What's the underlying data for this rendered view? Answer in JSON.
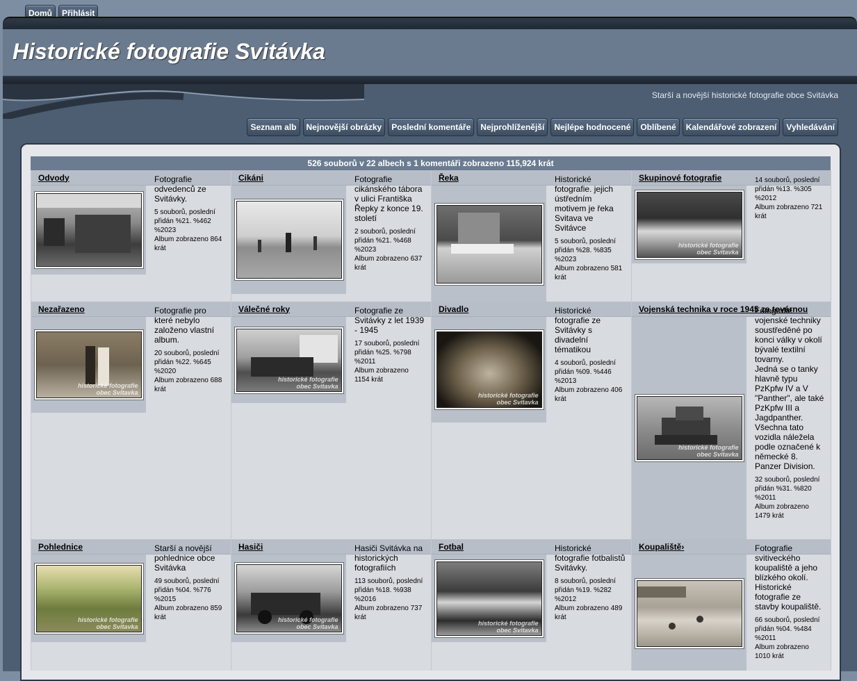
{
  "topnav": {
    "home": "Domů",
    "login": "Přihlásit"
  },
  "site": {
    "title": "Historické fotografie Svitávka",
    "description": "Starší a novější historické fotografie obce Svitávka"
  },
  "subnav": [
    "Seznam alb",
    "Nejnovější obrázky",
    "Poslední komentáře",
    "Nejprohlíženější",
    "Nejlépe hodnocené",
    "Oblíbené",
    "Kalendářové zobrazení",
    "Vyhledávání"
  ],
  "stats": "526 souborů v 22 albech s 1 komentáři zobrazeno 115,924 krát",
  "watermark": {
    "line1": "historické fotografie",
    "line2": "obec Svitavka"
  },
  "albums": [
    {
      "title": "Odvody",
      "desc": "Fotografie odvedenců ze Svitávky.",
      "files": "5 souborů, poslední přidán %21. %462 %2023",
      "views": "Album zobrazeno 864 krát"
    },
    {
      "title": "Cikáni",
      "desc": "Fotografie cikánského tábora v ulici Františka Řepky z konce 19. století",
      "files": "2 souborů, poslední přidán %21. %468 %2023",
      "views": "Album zobrazeno 637 krát"
    },
    {
      "title": "Řeka",
      "desc": "Historické fotografie. jejich ústředním motivem je řeka Svitava ve Svitávce",
      "files": "5 souborů, poslední přidán %28. %835 %2023",
      "views": "Album zobrazeno 581 krát"
    },
    {
      "title": "Skupinové fotografie",
      "desc": "",
      "files": "14 souborů, poslední přidán %13. %305 %2012",
      "views": "Album zobrazeno 721 krát"
    },
    {
      "title": "Nezařazeno",
      "desc": "Fotografie pro které nebylo založeno vlastní album.",
      "files": "20 souborů, poslední přidán %22. %645 %2020",
      "views": "Album zobrazeno 688 krát"
    },
    {
      "title": "Válečné roky",
      "desc": "Fotografie ze Svitávky z let 1939 - 1945",
      "files": "17 souborů, poslední přidán %25. %798 %2011",
      "views": "Album zobrazeno 1154 krát"
    },
    {
      "title": "Divadlo",
      "desc": "Historické fotografie ze Svitávky s divadelní tématikou",
      "files": "4 souborů, poslední přidán %09. %446 %2013",
      "views": "Album zobrazeno 406 krát"
    },
    {
      "title": "Vojenská technika v roce 1945 za továrnou",
      "desc": "Fotografie vojenské techniky soustředěné po konci války v okolí bývalé textilní tovarny.",
      "desc2": "Jedná se o tanky hlavně typu PzKpfw IV a V \"Panther\", ale také PzKpfw III a Jagdpanther. Všechna tato vozidla náležela podle označené k německé 8. Panzer Division.",
      "files": "32 souborů, poslední přidán %31. %820 %2011",
      "views": "Album zobrazeno 1479 krát"
    },
    {
      "title": "Pohlednice",
      "desc": "Starší a novější pohlednice obce Svitávka",
      "files": "49 souborů, poslední přidán %04. %776 %2015",
      "views": "Album zobrazeno 859 krát"
    },
    {
      "title": "Hasiči",
      "desc": "Hasiči Svitávka na historických fotografiích",
      "files": "113 souborů, poslední přidán %18. %938 %2016",
      "views": "Album zobrazeno 737 krát"
    },
    {
      "title": "Fotbal",
      "desc": "Historické fotografie fotbalistů Svitávky.",
      "files": "8 souborů, poslední přidán %19. %282 %2012",
      "views": "Album zobrazeno 489 krát"
    },
    {
      "title": "Koupaliště›",
      "desc": "Fotografie svitiveckého koupaliště a jeho blízkého okolí. Historické fotografie ze stavby koupaliště.",
      "files": "66 souborů, poslední přidán %04. %484 %2011",
      "views": "Album zobrazeno 1010 krát"
    }
  ]
}
